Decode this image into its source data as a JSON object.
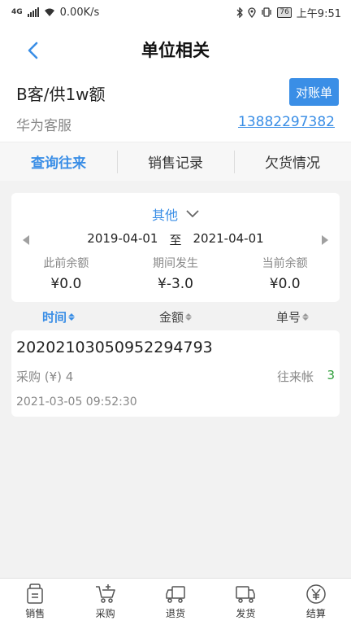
{
  "status": {
    "network": "4G",
    "speed": "0.00K/s",
    "battery": "76",
    "time": "上午9:51"
  },
  "nav": {
    "title": "单位相关"
  },
  "unit": {
    "name": "B客/供1w额",
    "statement_button": "对账单",
    "subtitle": "华为客服",
    "phone": "13882297382"
  },
  "tabs": [
    {
      "label": "查询往来",
      "active": true
    },
    {
      "label": "销售记录",
      "active": false
    },
    {
      "label": "欠货情况",
      "active": false
    }
  ],
  "summary": {
    "period": "其他",
    "start_date": "2019-04-01",
    "to_label": "至",
    "end_date": "2021-04-01",
    "stats": [
      {
        "label": "此前余额",
        "value": "¥0.0"
      },
      {
        "label": "期间发生",
        "value": "¥-3.0"
      },
      {
        "label": "当前余额",
        "value": "¥0.0"
      }
    ]
  },
  "sort": [
    {
      "label": "时间",
      "active": true
    },
    {
      "label": "金额",
      "active": false
    },
    {
      "label": "单号",
      "active": false
    }
  ],
  "records": [
    {
      "number": "20202103050952294793",
      "type": "采购 (¥) 4",
      "kind": "往来帐",
      "count": "3",
      "time": "2021-03-05 09:52:30"
    }
  ],
  "bottom_nav": [
    {
      "label": "销售",
      "icon": "sales-icon"
    },
    {
      "label": "采购",
      "icon": "purchase-cart-icon"
    },
    {
      "label": "退货",
      "icon": "return-truck-icon"
    },
    {
      "label": "发货",
      "icon": "delivery-truck-icon"
    },
    {
      "label": "结算",
      "icon": "settlement-yen-icon"
    }
  ],
  "colors": {
    "accent": "#3a8ee6",
    "count_green": "#2e9e3a"
  }
}
